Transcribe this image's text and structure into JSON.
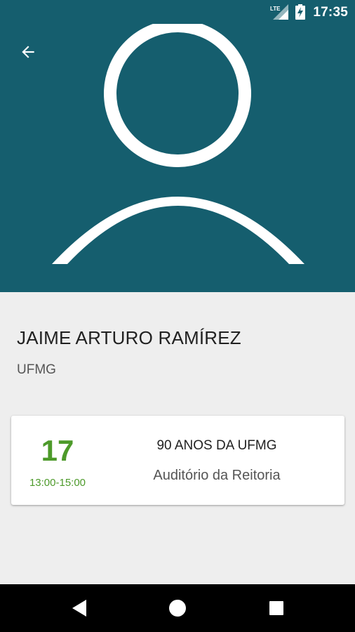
{
  "status_bar": {
    "network_label": "LTE",
    "time": "17:35",
    "icons": [
      "lte-signal-icon",
      "battery-charging-icon"
    ]
  },
  "header": {
    "back_icon": "arrow-left-icon",
    "avatar_icon": "person-placeholder-icon",
    "background_color": "#155e6e"
  },
  "profile": {
    "name": "JAIME ARTURO RAMÍREZ",
    "organization": "UFMG"
  },
  "events": [
    {
      "day": "17",
      "time": "13:00-15:00",
      "title": "90 ANOS DA UFMG",
      "location": "Auditório da Reitoria",
      "accent_color": "#4d9a2a"
    }
  ],
  "nav_bar": {
    "buttons": [
      "back-triangle-icon",
      "home-circle-icon",
      "recents-square-icon"
    ]
  }
}
